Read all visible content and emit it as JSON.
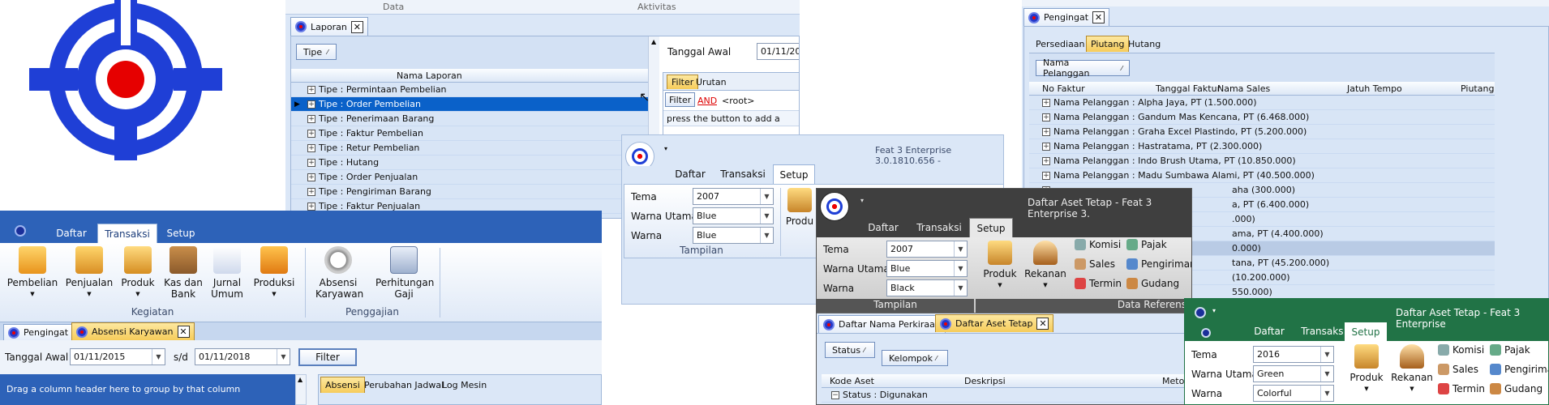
{
  "colors": {
    "ribbon_blue": "#2d62b8",
    "ribbon_bg": "#dbe7f7",
    "highlight": "#0a61c9",
    "dark_win": "#3f3f3f",
    "green_win": "#217346",
    "tab_orange": "#f6cc5a"
  },
  "logo": {
    "icon": "target-crosshair-logo"
  },
  "top_strip": {
    "data": "Data",
    "aktivitas": "Aktivitas"
  },
  "top_strip2": {
    "data": "Data",
    "aktivitas": "Aktivitas"
  },
  "laporan": {
    "tab": "Laporan",
    "group_chip": "Tipe",
    "column": "Nama Laporan",
    "rows": [
      "Tipe : Permintaan Pembelian",
      "Tipe : Order Pembelian",
      "Tipe : Penerimaan Barang",
      "Tipe : Faktur Pembelian",
      "Tipe : Retur Pembelian",
      "Tipe : Hutang",
      "Tipe : Order Penjualan",
      "Tipe : Pengiriman Barang",
      "Tipe : Faktur Penjualan"
    ],
    "tanggal_awal_label": "Tanggal Awal",
    "tanggal_awal_value": "01/11/20",
    "filter_tabs": [
      "Filter",
      "Urutan"
    ],
    "filter_btn": "Filter",
    "and_label": "AND",
    "root_label": "<root>",
    "hint": "press the button to add a new co"
  },
  "pengingat_right": {
    "tab": "Pengingat",
    "subtabs": [
      "Persediaan",
      "Piutang",
      "Hutang"
    ],
    "group_chip": "Nama Pelanggan",
    "columns": [
      "No Faktur",
      "Tanggal Faktur",
      "Nama Sales",
      "Jatuh Tempo",
      "Piutang"
    ],
    "rows": [
      "Nama Pelanggan : Alpha Jaya, PT (1.500.000)",
      "Nama Pelanggan : Gandum Mas Kencana, PT (6.468.000)",
      "Nama Pelanggan : Graha Excel Plastindo, PT (5.200.000)",
      "Nama Pelanggan : Hastratama, PT (2.300.000)",
      "Nama Pelanggan : Indo Brush Utama, PT (10.850.000)",
      "Nama Pelanggan : Madu Sumbawa Alami, PT (40.500.000)"
    ],
    "partial_rows": [
      "aha (300.000)",
      "a, PT (6.400.000)",
      ".000)",
      "ama, PT (4.400.000)",
      "0.000)",
      "tana, PT (45.200.000)",
      "(10.200.000)",
      "550.000)"
    ]
  },
  "feat_window": {
    "title": "Feat 3 Enterprise 3.0.1810.656 -",
    "tabs": [
      "Daftar",
      "Transaksi",
      "Setup"
    ],
    "tema_label": "Tema",
    "tema_value": "2007",
    "warna_utama_label": "Warna Utama",
    "warna_utama_value": "Blue",
    "warna_label": "Warna",
    "warna_value": "Blue",
    "group": "Tampilan",
    "produk_partial": "Produ"
  },
  "main_ribbon": {
    "tabs": [
      "Daftar",
      "Transaksi",
      "Setup"
    ],
    "buttons": [
      {
        "label": "Pembelian",
        "icon": "shopping-cart-icon"
      },
      {
        "label": "Penjualan",
        "icon": "sales-box-icon"
      },
      {
        "label": "Produk",
        "icon": "product-box-icon"
      },
      {
        "label": "Kas dan Bank",
        "icon": "cash-bank-icon"
      },
      {
        "label": "Jurnal Umum",
        "icon": "journal-document-icon"
      },
      {
        "label": "Produksi",
        "icon": "factory-icon"
      },
      {
        "label": "Absensi Karyawan",
        "icon": "alarm-clock-icon"
      },
      {
        "label": "Perhitungan Gaji",
        "icon": "calculator-icon"
      }
    ],
    "group_kegiatan": "Kegiatan",
    "group_penggajian": "Penggajian",
    "doc_tabs": [
      "Pengingat",
      "Absensi Karyawan"
    ],
    "tanggal_awal_label": "Tanggal Awal",
    "tanggal_awal_value": "01/11/2015",
    "sd_label": "s/d",
    "tanggal_akhir_value": "01/11/2018",
    "filter_btn": "Filter",
    "drag_hint": "Drag a column header here to group by that column",
    "inner_tabs": [
      "Absensi",
      "Perubahan Jadwal",
      "Log Mesin"
    ]
  },
  "dark_window": {
    "title": "Daftar Aset Tetap - Feat 3 Enterprise 3.",
    "tabs": [
      "Daftar",
      "Transaksi",
      "Setup"
    ],
    "tema_label": "Tema",
    "tema_value": "2007",
    "warna_utama_label": "Warna Utama",
    "warna_utama_value": "Blue",
    "warna_label": "Warna",
    "warna_value": "Black",
    "group_tampilan": "Tampilan",
    "group_ref": "Data Referens",
    "produk": "Produk",
    "rekanan": "Rekanan",
    "small": [
      "Komisi",
      "Sales",
      "Termin",
      "Pajak",
      "Pengiriman",
      "Gudang"
    ],
    "doc_tabs": [
      "Daftar Nama Perkiraan",
      "Daftar Aset Tetap"
    ],
    "chips": [
      "Status",
      "Kelompok"
    ],
    "columns": [
      "Kode Aset",
      "Deskripsi",
      "Metode"
    ],
    "row": "Status : Digunakan"
  },
  "green_window": {
    "title": "Daftar Aset Tetap - Feat 3 Enterprise",
    "tabs": [
      "Daftar",
      "Transaksi",
      "Setup"
    ],
    "tema_label": "Tema",
    "tema_value": "2016",
    "warna_utama_label": "Warna Utama",
    "warna_utama_value": "Green",
    "warna_label": "Warna",
    "warna_value": "Colorful",
    "produk": "Produk",
    "rekanan": "Rekanan",
    "small": [
      "Komisi",
      "Sales",
      "Termin",
      "Pajak",
      "Pengirima",
      "Gudang"
    ]
  }
}
